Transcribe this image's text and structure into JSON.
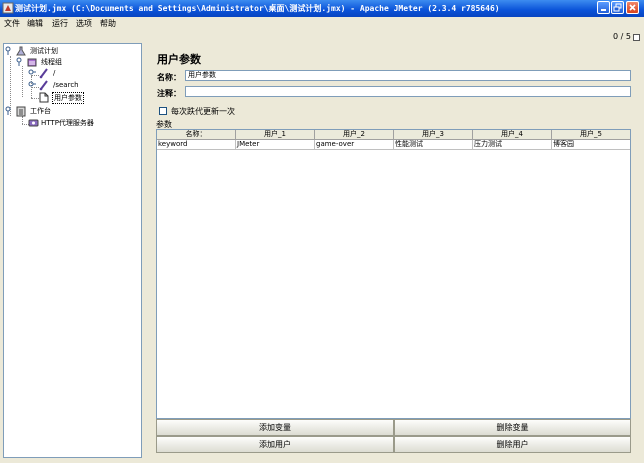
{
  "window": {
    "title": "测试计划.jmx (C:\\Documents and Settings\\Administrator\\桌面\\测试计划.jmx) - Apache JMeter (2.3.4 r785646)"
  },
  "menu": [
    "文件",
    "编辑",
    "运行",
    "选项",
    "帮助"
  ],
  "toolbar": {
    "counter": "0 / 5"
  },
  "tree": {
    "test_plan": "测试计划",
    "thread_group": "线程组",
    "sampler_root": "/",
    "sampler_search": "/search",
    "user_params": "用户参数",
    "workbench": "工作台",
    "http_proxy": "HTTP代理服务器"
  },
  "panel": {
    "title": "用户参数",
    "name_label": "名称：",
    "name_value": "用户参数",
    "comment_label": "注释：",
    "comment_value": "",
    "per_iteration_label": "每次跌代更新一次",
    "params_label": "参数"
  },
  "table": {
    "headers": [
      "名称：",
      "用户_1",
      "用户_2",
      "用户_3",
      "用户_4",
      "用户_5"
    ],
    "rows": [
      [
        "keyword",
        "JMeter",
        "game-over",
        "性能测试",
        "压力测试",
        "博客园"
      ]
    ]
  },
  "buttons": {
    "add_variable": "添加变量",
    "delete_variable": "删除变量",
    "add_user": "添加用户",
    "delete_user": "删除用户"
  },
  "colors": {
    "title_bar": "#0a52d8",
    "window_bg": "#ece9d8",
    "selection_border": "#000000"
  }
}
